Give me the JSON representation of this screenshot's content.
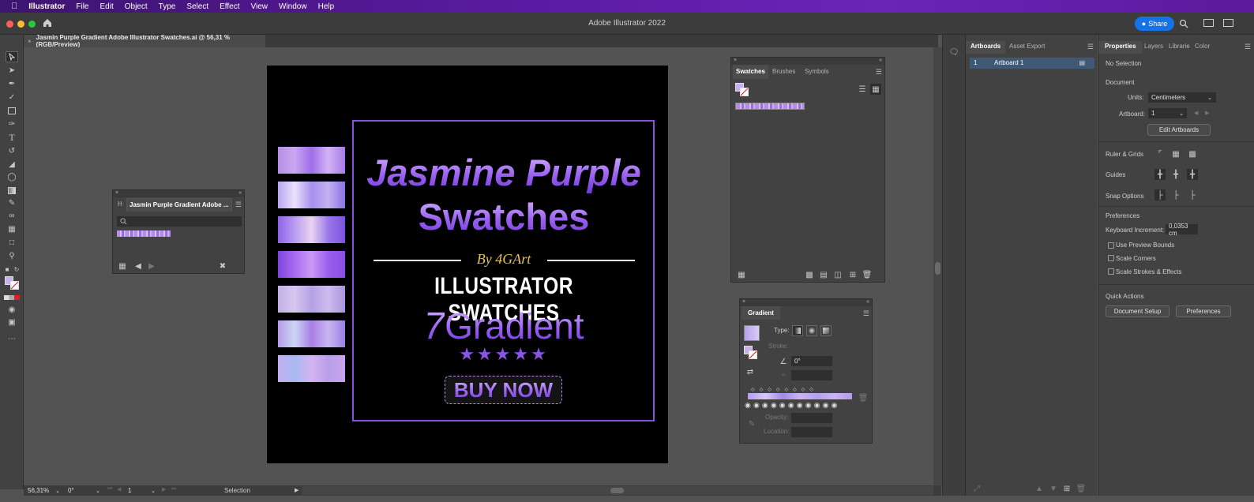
{
  "menubar": {
    "apple_icon": "apple-icon",
    "app_name": "Illustrator",
    "items": [
      "File",
      "Edit",
      "Object",
      "Type",
      "Select",
      "Effect",
      "View",
      "Window",
      "Help"
    ]
  },
  "titlebar": {
    "title": "Adobe Illustrator 2022",
    "share_label": "Share"
  },
  "document_tab": {
    "title": "Jasmin Purple Gradient Adobe Illustrator Swatches.ai @ 56,31 % (RGB/Preview)"
  },
  "artwork": {
    "title_line1": "Jasmine Purple",
    "title_line2": "Swatches",
    "byline": "By 4GArt",
    "subtitle": "ILLUSTRATOR SWATCHES",
    "count_number": "7",
    "count_word": "Gradient",
    "stars": "★★★★★",
    "cta": "BUY NOW",
    "bar_gradients": [
      "linear-gradient(90deg,#b98ee8,#c9a6f0,#9f6ee8,#d2b4f5,#a77ae8)",
      "linear-gradient(90deg,#b6a6f0,#eae2fb,#a690ee,#c2b2f2,#8a72e6)",
      "linear-gradient(90deg,#8e62e8,#b89cf0,#e8d4f0,#9a78ea,#7b52e0)",
      "linear-gradient(90deg,#7f42e0,#a86cf0,#c99af5,#9b5eec,#8a4ee6)",
      "linear-gradient(90deg,#c1b2e6,#d7c6ee,#b3a2e2,#cdbbee,#a996dc)",
      "linear-gradient(90deg,#b59ce8,#cdd6f5,#a97ee6,#c8b6f0,#9a7ee4)",
      "linear-gradient(90deg,#c2b0f2,#a8b8f0,#d5b4f2,#b89ee8,#c8a4ec)"
    ]
  },
  "library_panel": {
    "tab_hidden": "H",
    "tab_active": "Jasmin Purple Gradient Adobe ..."
  },
  "swatches_panel": {
    "tabs": [
      "Swatches",
      "Brushes",
      "Symbols"
    ]
  },
  "gradient_panel": {
    "title": "Gradient",
    "type_label": "Type:",
    "stroke_label": "Stroke:",
    "angle_value": "0°",
    "opacity_label": "Opacity:",
    "location_label": "Location:"
  },
  "artboards_panel": {
    "tabs": [
      "Artboards",
      "Asset Export"
    ],
    "rows": [
      {
        "index": "1",
        "name": "Artboard 1"
      }
    ]
  },
  "properties_panel": {
    "tabs": [
      "Properties",
      "Layers",
      "Librarie",
      "Color"
    ],
    "no_selection": "No Selection",
    "document_heading": "Document",
    "units_label": "Units:",
    "units_value": "Centimeters",
    "artboard_label": "Artboard:",
    "artboard_value": "1",
    "edit_artboards": "Edit Artboards",
    "ruler_grids": "Ruler & Grids",
    "guides": "Guides",
    "snap_options": "Snap Options",
    "preferences_heading": "Preferences",
    "keyboard_increment_label": "Keyboard Increment:",
    "keyboard_increment_value": "0,0353 cm",
    "checkboxes": [
      "Use Preview Bounds",
      "Scale Corners",
      "Scale Strokes & Effects"
    ],
    "quick_actions": "Quick Actions",
    "document_setup": "Document Setup",
    "preferences_button": "Preferences"
  },
  "statusbar": {
    "zoom": "56,31%",
    "rotation": "0°",
    "artboard_nav": "1",
    "tool": "Selection"
  },
  "colors": {
    "accent_purple": "#8a4fe0",
    "share_blue": "#1473e6",
    "byline_gold": "#e6c34a"
  }
}
